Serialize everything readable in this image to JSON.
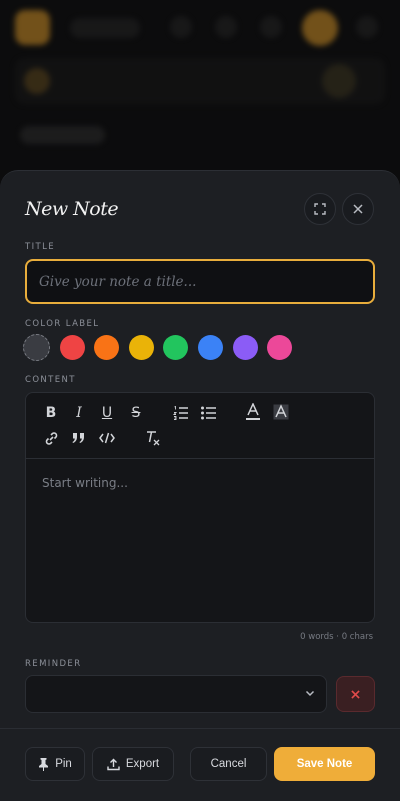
{
  "sheet": {
    "title": "New Note"
  },
  "title_field": {
    "label": "TITLE",
    "placeholder": "Give your note a title...",
    "value": ""
  },
  "color_label": {
    "label": "COLOR LABEL",
    "options": [
      {
        "name": "none",
        "color": "#3a3c42",
        "selected": true
      },
      {
        "name": "red",
        "color": "#ef4444"
      },
      {
        "name": "orange",
        "color": "#f97316"
      },
      {
        "name": "yellow",
        "color": "#eab308"
      },
      {
        "name": "green",
        "color": "#22c55e"
      },
      {
        "name": "blue",
        "color": "#3b82f6"
      },
      {
        "name": "purple",
        "color": "#8b5cf6"
      },
      {
        "name": "pink",
        "color": "#ec4899"
      }
    ]
  },
  "content": {
    "label": "CONTENT",
    "placeholder": "Start writing...",
    "counter": "0 words · 0 chars",
    "toolbar": [
      "bold-icon",
      "italic-icon",
      "underline-icon",
      "strikethrough-icon",
      "ordered-list-icon",
      "bullet-list-icon",
      "text-color-icon",
      "highlight-icon",
      "link-icon",
      "quote-icon",
      "code-icon",
      "clear-format-icon"
    ]
  },
  "reminder": {
    "label": "REMINDER",
    "value": ""
  },
  "footer": {
    "pin_label": "Pin",
    "export_label": "Export",
    "cancel_label": "Cancel",
    "save_label": "Save Note"
  },
  "colors": {
    "accent": "#efad39",
    "sheet_bg": "#1d1f23",
    "danger": "#e24b4b"
  }
}
